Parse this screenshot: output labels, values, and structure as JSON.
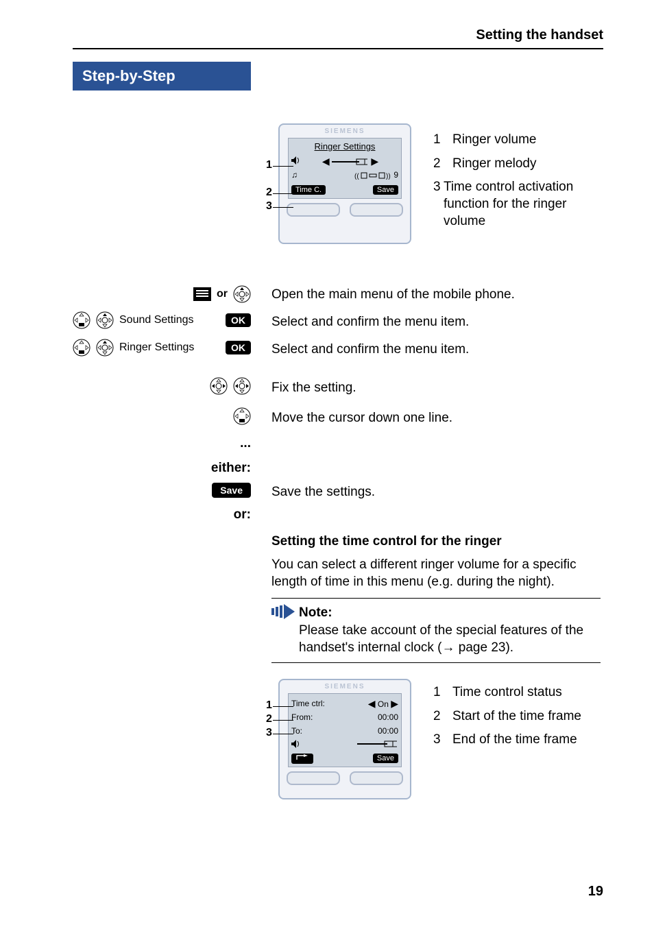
{
  "header": {
    "title": "Setting the handset"
  },
  "banner": {
    "title": "Step-by-Step"
  },
  "page_number": "19",
  "device1": {
    "brand": "SIEMENS",
    "screen_title": "Ringer Settings",
    "melody_value": "9",
    "left_softlabel": "Time C.",
    "right_softlabel": "Save",
    "callouts": {
      "c1": "1",
      "c2": "2",
      "c3": "3"
    }
  },
  "legend1": {
    "items": [
      {
        "num": "1",
        "text": "Ringer volume"
      },
      {
        "num": "2",
        "text": "Ringer melody"
      },
      {
        "num": "3",
        "text": "Time control activation function for the ringer volume"
      }
    ]
  },
  "steps": {
    "open_menu_or": "or",
    "open_menu_text": "Open the main menu of the mobile phone.",
    "sound_settings_label": "Sound Settings",
    "ok_label": "OK",
    "sound_settings_text": "Select and confirm the menu item.",
    "ringer_settings_label": "Ringer Settings",
    "ringer_settings_text": "Select and confirm the menu item.",
    "fix_setting_text": "Fix the setting.",
    "move_cursor_text": "Move the cursor down one line.",
    "ellipsis": "...",
    "either_label": "either:",
    "save_label": "Save",
    "save_text": "Save the settings.",
    "or_label": "or:"
  },
  "subsection": {
    "heading": "Setting the time control for the ringer",
    "para": "You can select a different ringer volume for a specific length of time in this menu (e.g. during the night)."
  },
  "note": {
    "title": "Note:",
    "body_before_arrow": "Please take account of the special features of the handset's internal clock (",
    "body_after_arrow": " page 23).",
    "arrow": "→"
  },
  "device2": {
    "brand": "SIEMENS",
    "rows": {
      "time_ctrl_label": "Time ctrl:",
      "time_ctrl_value": "On",
      "from_label": "From:",
      "from_value": "00:00",
      "to_label": "To:",
      "to_value": "00:00"
    },
    "left_soft_icon": "back-arrow",
    "right_softlabel": "Save",
    "callouts": {
      "c1": "1",
      "c2": "2",
      "c3": "3"
    }
  },
  "legend2": {
    "items": [
      {
        "num": "1",
        "text": "Time control status"
      },
      {
        "num": "2",
        "text": "Start of the time frame"
      },
      {
        "num": "3",
        "text": "End of the time frame"
      }
    ]
  }
}
